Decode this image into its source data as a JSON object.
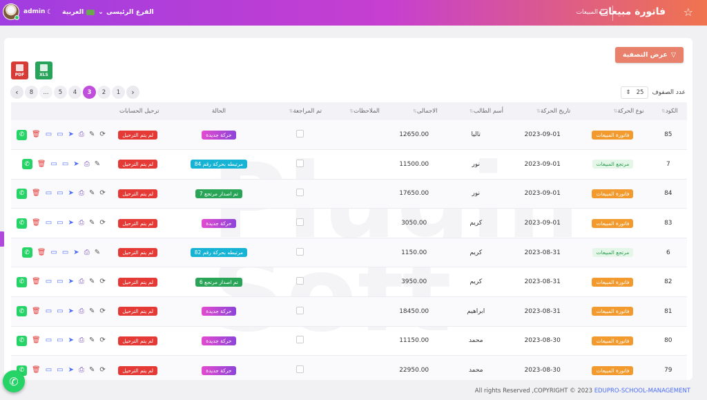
{
  "topbar": {
    "user": "admin",
    "language": "العربية",
    "branch": "الفرع الرئيسى",
    "title": "فاتورة مبيعات",
    "breadcrumb": "المبيعات"
  },
  "toolbar": {
    "filter_label": "عرض التصفية",
    "pdf_label": "PDF",
    "xls_label": "XLS",
    "rows_label": "عدد الصفوف",
    "rows_value": "25"
  },
  "pagination": {
    "pages": [
      "1",
      "2",
      "3",
      "4",
      "5",
      "...",
      "8"
    ],
    "active": "3"
  },
  "columns": [
    "الكود",
    "نوع الحركة",
    "تاريخ الحركة",
    "أسم الطالب",
    "الاجمالى",
    "الملاحظات",
    "تم المراجعة",
    "الحالة",
    "ترحيل الحسابات"
  ],
  "rows": [
    {
      "code": "85",
      "type": "فاتورة المبيعات",
      "type_style": "orange",
      "date": "2023-09-01",
      "student": "تاليا",
      "total": "12650.00",
      "status": "حركة جديدة",
      "status_style": "purple",
      "posting": "لم يتم الترحيل",
      "refresh": true
    },
    {
      "code": "7",
      "type": "مرتجع المبيعات",
      "type_style": "green-light",
      "date": "2023-09-01",
      "student": "نور",
      "total": "11500.00",
      "status": "مرتبطه بحركة رقم 84",
      "status_style": "teal",
      "posting": "لم يتم الترحيل",
      "refresh": false
    },
    {
      "code": "84",
      "type": "فاتورة المبيعات",
      "type_style": "orange",
      "date": "2023-09-01",
      "student": "نور",
      "total": "17650.00",
      "status": "تم اصدار مرتجع 7",
      "status_style": "green",
      "posting": "لم يتم الترحيل",
      "refresh": true
    },
    {
      "code": "83",
      "type": "فاتورة المبيعات",
      "type_style": "orange",
      "date": "2023-09-01",
      "student": "كريم",
      "total": "3050.00",
      "status": "حركة جديدة",
      "status_style": "purple",
      "posting": "لم يتم الترحيل",
      "refresh": true
    },
    {
      "code": "6",
      "type": "مرتجع المبيعات",
      "type_style": "green-light",
      "date": "2023-08-31",
      "student": "كريم",
      "total": "1150.00",
      "status": "مرتبطه بحركة رقم 82",
      "status_style": "teal",
      "posting": "لم يتم الترحيل",
      "refresh": false
    },
    {
      "code": "82",
      "type": "فاتورة المبيعات",
      "type_style": "orange",
      "date": "2023-08-31",
      "student": "كريم",
      "total": "3950.00",
      "status": "تم اصدار مرتجع 6",
      "status_style": "green",
      "posting": "لم يتم الترحيل",
      "refresh": true
    },
    {
      "code": "81",
      "type": "فاتورة المبيعات",
      "type_style": "orange",
      "date": "2023-08-31",
      "student": "ابراهيم",
      "total": "18450.00",
      "status": "حركة جديدة",
      "status_style": "purple",
      "posting": "لم يتم الترحيل",
      "refresh": true
    },
    {
      "code": "80",
      "type": "فاتورة المبيعات",
      "type_style": "orange",
      "date": "2023-08-30",
      "student": "محمد",
      "total": "11150.00",
      "status": "حركة جديدة",
      "status_style": "purple",
      "posting": "لم يتم الترحيل",
      "refresh": true
    },
    {
      "code": "79",
      "type": "فاتورة المبيعات",
      "type_style": "orange",
      "date": "2023-08-30",
      "student": "محمد",
      "total": "22950.00",
      "status": "حركة جديدة",
      "status_style": "purple",
      "posting": "لم يتم الترحيل",
      "refresh": true
    }
  ],
  "watermark": "Plugin Soft",
  "footer": {
    "text": "All rights Reserved ,COPYRIGHT © 2023 ",
    "brand": "EDUPRO-SCHOOL-MANAGEMENT"
  },
  "colors": {
    "accent": "#c04ddb",
    "filter": "#e8806b",
    "whatsapp": "#25d366"
  }
}
